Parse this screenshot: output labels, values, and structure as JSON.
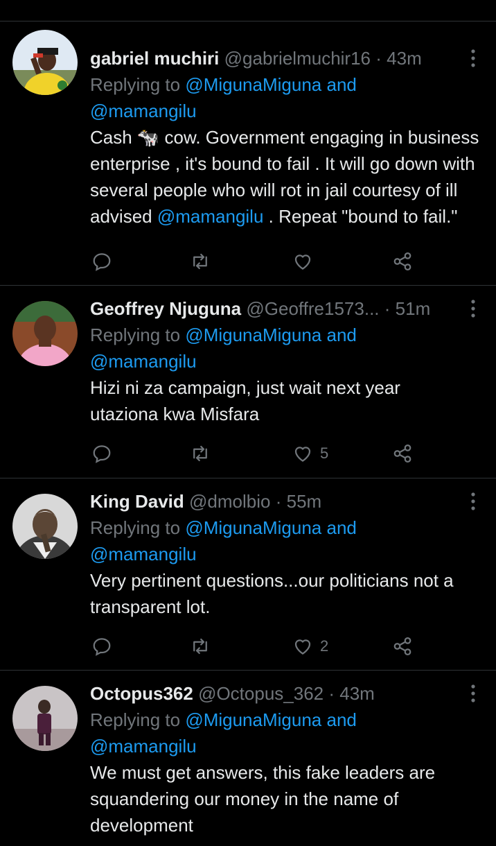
{
  "colors": {
    "background": "#000000",
    "text": "#e7e9ea",
    "muted": "#71767b",
    "accent": "#1d9bf0",
    "divider": "#2f3336"
  },
  "icons": {
    "reply": "reply-icon",
    "retweet": "retweet-icon",
    "like": "heart-icon",
    "share": "share-icon",
    "more": "more-options-icon"
  },
  "tweets": [
    {
      "name": "gabriel muchiri",
      "handle": "@gabrielmuchir16",
      "separator": "·",
      "time": "43m",
      "reply_prefix": "Replying to",
      "reply_mention_1": "@MigunaMiguna",
      "reply_and": "and",
      "reply_mention_2": "@mamangilu",
      "text_before": "Cash 🐄 cow. Government engaging in business enterprise , it's bound to fail . It will go down with several people who will rot in jail courtesy of ill advised",
      "text_mention": "@mamangilu",
      "text_after": ". Repeat \"bound to fail.\"",
      "likes": ""
    },
    {
      "name": "Geoffrey Njuguna",
      "handle": "@Geoffre1573...",
      "separator": "·",
      "time": "51m",
      "reply_prefix": "Replying to",
      "reply_mention_1": "@MigunaMiguna",
      "reply_and": "and",
      "reply_mention_2": "@mamangilu",
      "text": "Hizi ni za campaign, just wait next year utaziona kwa Misfara",
      "likes": "5"
    },
    {
      "name": "King David",
      "handle": "@dmolbio",
      "separator": "·",
      "time": "55m",
      "reply_prefix": "Replying to",
      "reply_mention_1": "@MigunaMiguna",
      "reply_and": "and",
      "reply_mention_2": "@mamangilu",
      "text": "Very pertinent questions...our politicians not a transparent lot.",
      "likes": "2"
    },
    {
      "name": "Octopus362",
      "handle": "@Octopus_362",
      "separator": "·",
      "time": "43m",
      "reply_prefix": "Replying to",
      "reply_mention_1": "@MigunaMiguna",
      "reply_and": "and",
      "reply_mention_2": "@mamangilu",
      "text": "We must get answers, this fake leaders are squandering our money in the name of development",
      "likes": ""
    }
  ]
}
